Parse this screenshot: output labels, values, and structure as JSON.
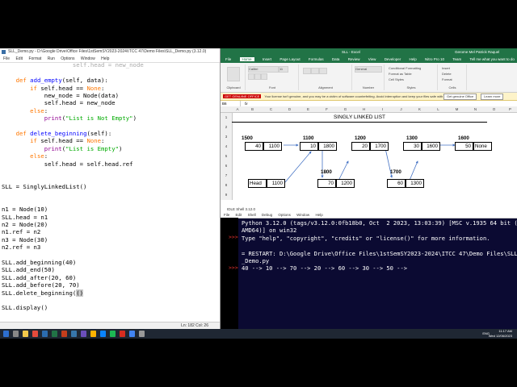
{
  "editor": {
    "title": "SLL_Demo.py - D:\\Google Drive\\Office Files\\1stSemSY2023-2024\\ITCC 47\\Demo Files\\SLL_Demo.py (3.12.0)",
    "menu": [
      "File",
      "Edit",
      "Format",
      "Run",
      "Options",
      "Window",
      "Help"
    ],
    "status": "Ln: 182  Col: 26"
  },
  "excel": {
    "title": "SLL - Excel",
    "user": "Gerome Mel Patrick Raquel",
    "tabs": [
      "File",
      "Home",
      "Insert",
      "Page Layout",
      "Formulas",
      "Data",
      "Review",
      "View",
      "Developer",
      "Help",
      "Nitro Pro 10",
      "Team",
      "Tell me what you want to do"
    ],
    "active_tab": "Home",
    "ribbon": {
      "clipboard": "Clipboard",
      "font_name": "Calibri",
      "font_size": "11",
      "font": "Font",
      "alignment": "Alignment",
      "number_format": "General",
      "number": "Number",
      "cond_format": "Conditional Formatting",
      "format_table": "Format as Table",
      "cell_styles": "Cell Styles",
      "styles": "Styles",
      "insert": "Insert",
      "delete": "Delete",
      "format": "Format",
      "cells": "Cells"
    },
    "security_bar": {
      "tag": "GET GENUINE OFFICE",
      "message": "Your license isn't genuine, and you may be a victim of software counterfeiting. Avoid interruption and keep your files safe with genuine Office today.",
      "button1": "Get genuine Office",
      "button2": "Learn more"
    },
    "name_box": "B6",
    "formula": "fx",
    "columns": [
      "A",
      "B",
      "C",
      "D",
      "E",
      "F",
      "G",
      "H",
      "I",
      "J",
      "K",
      "L",
      "M",
      "N",
      "O",
      "P"
    ],
    "rows": [
      "1",
      "2",
      "3",
      "4",
      "5",
      "6",
      "7",
      "8",
      "9"
    ],
    "sheet_title": "SINGLY LINKED LIST",
    "nodes": [
      {
        "addr": "1500",
        "data": "40",
        "next": "1100"
      },
      {
        "addr": "1100",
        "data": "10",
        "next": "1800"
      },
      {
        "addr": "1200",
        "data": "20",
        "next": "1700"
      },
      {
        "addr": "1300",
        "data": "30",
        "next": "1600"
      },
      {
        "addr": "1600",
        "data": "50",
        "next": "None"
      }
    ],
    "lower_nodes": [
      {
        "addr": "1800",
        "data": "70",
        "next": "1200"
      },
      {
        "addr": "1700",
        "data": "60",
        "next": "1300"
      }
    ],
    "head_label": "Head",
    "head_value": "1100"
  },
  "shell": {
    "title": "IDLE Shell 3.12.0",
    "menu": [
      "File",
      "Edit",
      "Shell",
      "Debug",
      "Options",
      "Window",
      "Help"
    ],
    "prompt": ">>>",
    "lines": [
      "Python 3.12.0 (tags/v3.12.0:0fb18b0, Oct  2 2023, 13:03:39) [MSC v.1935 64 bit (",
      "AMD64)] on win32",
      "Type \"help\", \"copyright\", \"credits\" or \"license()\" for more information.",
      "",
      "= RESTART: D:\\Google Drive\\Office Files\\1stSemSY2023-2024\\ITCC 47\\Demo Files\\SLL",
      "_Demo.py",
      "40 --> 10 --> 70 --> 20 --> 60 --> 30 --> 50 -->"
    ]
  },
  "taskbar": {
    "time": "11:17 AM",
    "date": "Wed 12/06/2023",
    "lang": "ENG"
  }
}
